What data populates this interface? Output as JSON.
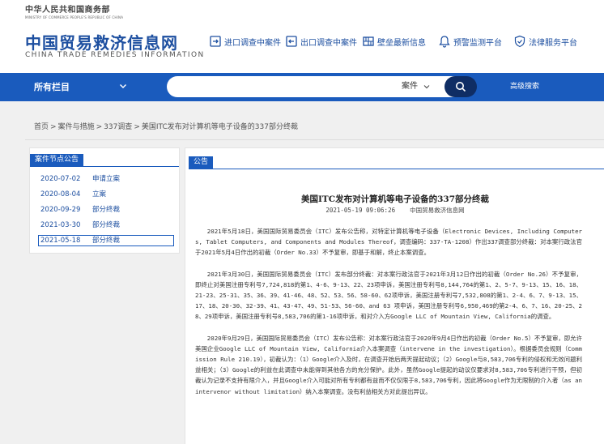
{
  "header": {
    "ministry_cn": "中华人民共和国商务部",
    "ministry_en": "MINISTRY OF COMMERCE PEOPLE'S REPUBLIC OF CHINA",
    "site_title": "中国贸易救济信息网",
    "site_title_en": "CHINA TRADE REMEDIES INFORMATION",
    "links": [
      {
        "label": "进口调查中案件",
        "icon": "import-case-icon"
      },
      {
        "label": "出口调查中案件",
        "icon": "export-case-icon"
      },
      {
        "label": "壁垒最新信息",
        "icon": "barrier-news-icon"
      },
      {
        "label": "预警监测平台",
        "icon": "bell-icon"
      },
      {
        "label": "法律服务平台",
        "icon": "shield-icon"
      }
    ]
  },
  "navbar": {
    "all_columns": "所有栏目",
    "search_placeholder": "",
    "search_category": "案件",
    "advanced_search": "高级搜索"
  },
  "breadcrumb": [
    "首页",
    "案件与措施",
    "337调查",
    "美国ITC发布对计算机等电子设备的337部分终裁"
  ],
  "left_panel": {
    "title": "案件节点公告",
    "items": [
      {
        "date": "2020-07-02",
        "stage": "申请立案"
      },
      {
        "date": "2020-08-04",
        "stage": "立案"
      },
      {
        "date": "2020-09-29",
        "stage": "部分终裁"
      },
      {
        "date": "2021-03-30",
        "stage": "部分终裁"
      },
      {
        "date": "2021-05-18",
        "stage": "部分终裁"
      }
    ]
  },
  "article": {
    "tab": "公告",
    "title": "美国ITC发布对计算机等电子设备的337部分终裁",
    "date": "2021-05-19 09:06:26",
    "source": "中国贸易救济信息网",
    "paragraphs": [
      "2021年5月18日，美国国际贸易委员会（ITC）发布公告称，对特定计算机等电子设备（Electronic Devices, Including Computers, Tablet Computers, and Components and Modules Thereof，调查编码：337-TA-1208）作出337调查部分终裁：对本案行政法官于2021年5月4日作出的初裁（Order No.33）不予复审，即基于和解，终止本案调查。",
      "2021年3月30日，美国国际贸易委员会（ITC）发布部分终裁：对本案行政法官于2021年3月12日作出的初裁（Order No.26）不予复审，即终止对美国注册专利号7,724,818的第1、4-6、9-13、22、23项申诉，美国注册专利号8,144,764的第1、2、5-7、9-13、15、16、18、21-23、25-31、35、36、39、41-46、48、52、53、56、58-60、62项申诉，美国注册专利号7,532,808的第1、2-4、6、7、9-13、15、17、18、20-30、32-39、41、43-47、49、51-53、56-60、and 63 项申诉，美国注册专利号6,950,469的第2-4、6、7、16、20-25、28、29项申诉，美国注册专利号8,583,706的第1-16项申诉，和对介入方Google LLC of Mountain View, California的调查。",
      "2020年9月29日，美国国际贸易委员会（ITC）发布公告称：对本案行政法官于2020年9月4日作出的初裁（Order No.5）不予复审，即允许美国企业Google LLC of Mountain View, California介入本案调查（intervene in the investigation）。根据委员会规则（Commission Rule 210.19），初裁认为：（1）Google介入及时，在调查开始后两天提起动议；（2）Google与8,583,706专利的侵权和无效问题利益相关；（3）Google的利益在此调查中未能得到其他各方的充分保护。此外，虽然Google提起的动议仅要求对8,583,706专利进行干预，但初裁认为记录不支持有限介入，并且Google介入可能对所有专利都有益而不仅仅限于8,583,706专利，因此将Google作为无限制的介入者（as an intervenor without limitation）纳入本案调查。没有利益相关方对此提出异议。"
    ]
  },
  "colors": {
    "brand_blue": "#1a5bbd",
    "title_blue": "#1d4fa0",
    "search_button": "#0f2d64",
    "content_bg": "#f0f0f0"
  }
}
